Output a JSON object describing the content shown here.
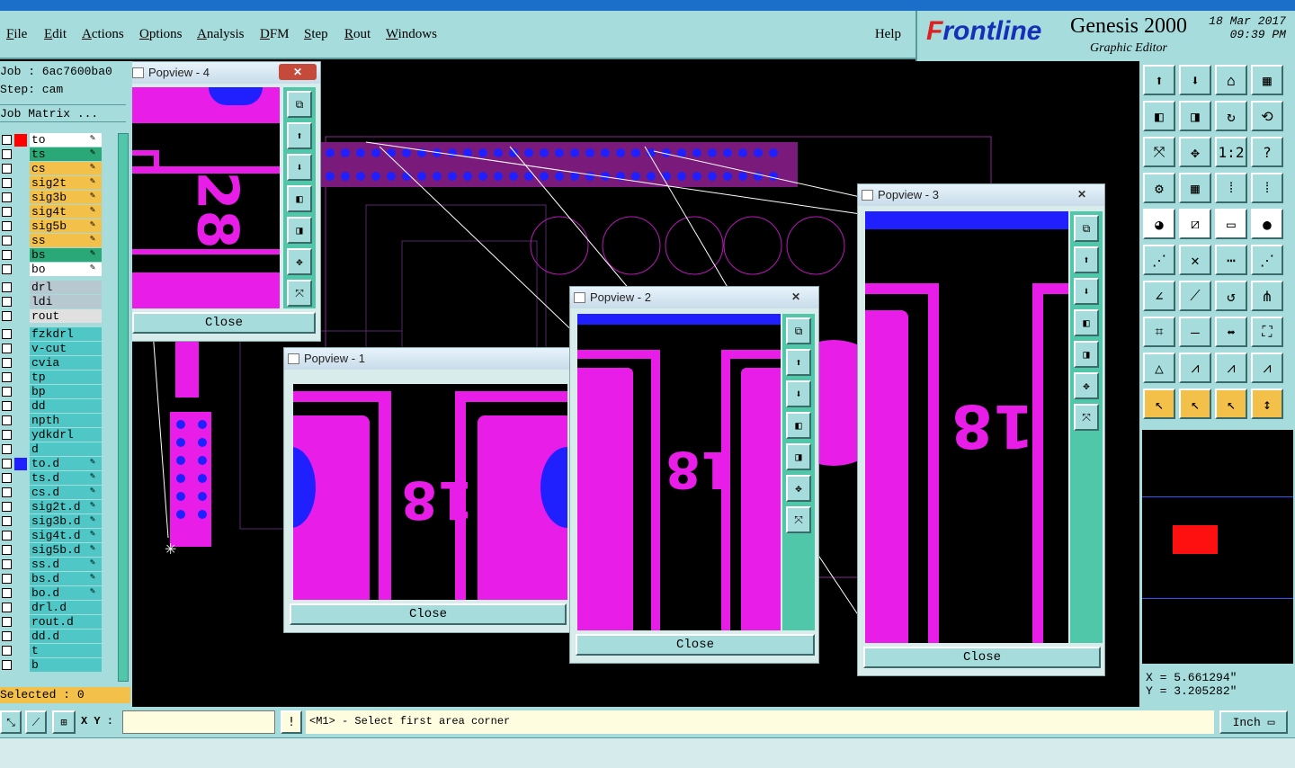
{
  "window": {
    "title_fragment": "Graphic Editor"
  },
  "menu": {
    "items": [
      {
        "label": "File",
        "u": "F",
        "rest": "ile"
      },
      {
        "label": "Edit",
        "u": "E",
        "rest": "dit"
      },
      {
        "label": "Actions",
        "u": "A",
        "rest": "ctions"
      },
      {
        "label": "Options",
        "u": "O",
        "rest": "ptions"
      },
      {
        "label": "Analysis",
        "u": "A",
        "rest": "nalysis"
      },
      {
        "label": "DFM",
        "u": "D",
        "rest": "FM"
      },
      {
        "label": "Step",
        "u": "S",
        "rest": "tep"
      },
      {
        "label": "Rout",
        "u": "R",
        "rest": "out"
      },
      {
        "label": "Windows",
        "u": "W",
        "rest": "indows"
      }
    ],
    "help": "Help"
  },
  "brand": {
    "logo_f": "F",
    "logo_rest": "rontline",
    "product": "Genesis 2000",
    "subtitle": "Graphic Editor",
    "date": "18 Mar 2017",
    "time": "09:39 PM"
  },
  "left": {
    "job": "Job : 6ac7600ba0",
    "step": "Step: cam",
    "matrix": "Job Matrix ...",
    "selected": "Selected : 0",
    "layers": [
      {
        "name": "to",
        "color": "#ffffff",
        "sw": "#ff0000",
        "edit": true
      },
      {
        "name": "ts",
        "color": "#2aa878",
        "sw": "",
        "edit": true
      },
      {
        "name": "cs",
        "color": "#f3c04a",
        "sw": "",
        "edit": true
      },
      {
        "name": "sig2t",
        "color": "#f3c04a",
        "sw": "",
        "edit": true
      },
      {
        "name": "sig3b",
        "color": "#f3c04a",
        "sw": "",
        "edit": true
      },
      {
        "name": "sig4t",
        "color": "#f3c04a",
        "sw": "",
        "edit": true
      },
      {
        "name": "sig5b",
        "color": "#f3c04a",
        "sw": "",
        "edit": true
      },
      {
        "name": "ss",
        "color": "#f3c04a",
        "sw": "",
        "edit": true
      },
      {
        "name": "bs",
        "color": "#2aa878",
        "sw": "",
        "edit": true
      },
      {
        "name": "bo",
        "color": "#ffffff",
        "sw": "",
        "edit": true
      },
      {
        "name": "drl",
        "color": "#b8c8d0",
        "sw": "",
        "edit": false
      },
      {
        "name": "ldi",
        "color": "#b8c8d0",
        "sw": "",
        "edit": false
      },
      {
        "name": "rout",
        "color": "#e0e0e0",
        "sw": "",
        "edit": false
      },
      {
        "name": "fzkdrl",
        "color": "#4fc7c7",
        "sw": "",
        "edit": false
      },
      {
        "name": "v-cut",
        "color": "#4fc7c7",
        "sw": "",
        "edit": false
      },
      {
        "name": "cvia",
        "color": "#4fc7c7",
        "sw": "",
        "edit": false
      },
      {
        "name": "tp",
        "color": "#4fc7c7",
        "sw": "",
        "edit": false
      },
      {
        "name": "bp",
        "color": "#4fc7c7",
        "sw": "",
        "edit": false
      },
      {
        "name": "dd",
        "color": "#4fc7c7",
        "sw": "",
        "edit": false
      },
      {
        "name": "npth",
        "color": "#4fc7c7",
        "sw": "",
        "edit": false
      },
      {
        "name": "ydkdrl",
        "color": "#4fc7c7",
        "sw": "",
        "edit": false
      },
      {
        "name": "d",
        "color": "#4fc7c7",
        "sw": "",
        "edit": false
      },
      {
        "name": "to.d",
        "color": "#4fc7c7",
        "sw": "#2020ff",
        "edit": true
      },
      {
        "name": "ts.d",
        "color": "#4fc7c7",
        "sw": "",
        "edit": true
      },
      {
        "name": "cs.d",
        "color": "#4fc7c7",
        "sw": "",
        "edit": true
      },
      {
        "name": "sig2t.d",
        "color": "#4fc7c7",
        "sw": "",
        "edit": true
      },
      {
        "name": "sig3b.d",
        "color": "#4fc7c7",
        "sw": "",
        "edit": true
      },
      {
        "name": "sig4t.d",
        "color": "#4fc7c7",
        "sw": "",
        "edit": true
      },
      {
        "name": "sig5b.d",
        "color": "#4fc7c7",
        "sw": "",
        "edit": true
      },
      {
        "name": "ss.d",
        "color": "#4fc7c7",
        "sw": "",
        "edit": true
      },
      {
        "name": "bs.d",
        "color": "#4fc7c7",
        "sw": "",
        "edit": true
      },
      {
        "name": "bo.d",
        "color": "#4fc7c7",
        "sw": "",
        "edit": true
      },
      {
        "name": "drl.d",
        "color": "#4fc7c7",
        "sw": "",
        "edit": false
      },
      {
        "name": "rout.d",
        "color": "#4fc7c7",
        "sw": "",
        "edit": false
      },
      {
        "name": "dd.d",
        "color": "#4fc7c7",
        "sw": "",
        "edit": false
      },
      {
        "name": "t",
        "color": "#4fc7c7",
        "sw": "",
        "edit": false
      },
      {
        "name": "b",
        "color": "#4fc7c7",
        "sw": "",
        "edit": false
      }
    ]
  },
  "popups": {
    "p4": {
      "title": "Popview - 4",
      "close": "Close",
      "label": "28"
    },
    "p1": {
      "title": "Popview - 1",
      "close": "Close",
      "label": "18"
    },
    "p2": {
      "title": "Popview - 2",
      "close": "Close",
      "label": "18"
    },
    "p3": {
      "title": "Popview - 3",
      "close": "Close",
      "label": "18"
    }
  },
  "right": {
    "x": "X = 5.661294\"",
    "y": "Y = 3.205282\""
  },
  "status": {
    "xy_label": "X Y :",
    "xy_value": "",
    "excl": "!",
    "prompt": "<M1> - Select first area corner",
    "units": "Inch"
  },
  "colors": {
    "panel": "#a6dcdc",
    "magenta": "#e81ee8",
    "blue": "#2020ff"
  }
}
